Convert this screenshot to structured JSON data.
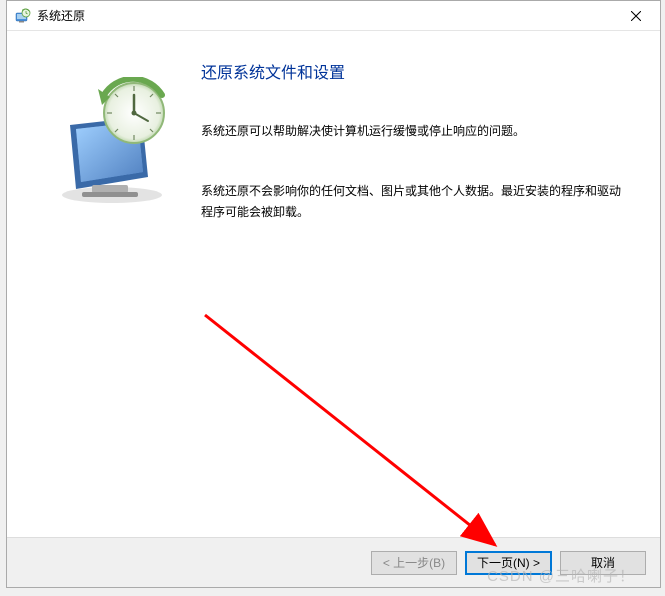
{
  "window": {
    "title": "系统还原"
  },
  "content": {
    "heading": "还原系统文件和设置",
    "para1": "系统还原可以帮助解决使计算机运行缓慢或停止响应的问题。",
    "para2": "系统还原不会影响你的任何文档、图片或其他个人数据。最近安装的程序和驱动程序可能会被卸载。"
  },
  "footer": {
    "back": "< 上一步(B)",
    "next": "下一页(N) >",
    "cancel": "取消"
  },
  "watermark": "CSDN @三哈喇子！"
}
